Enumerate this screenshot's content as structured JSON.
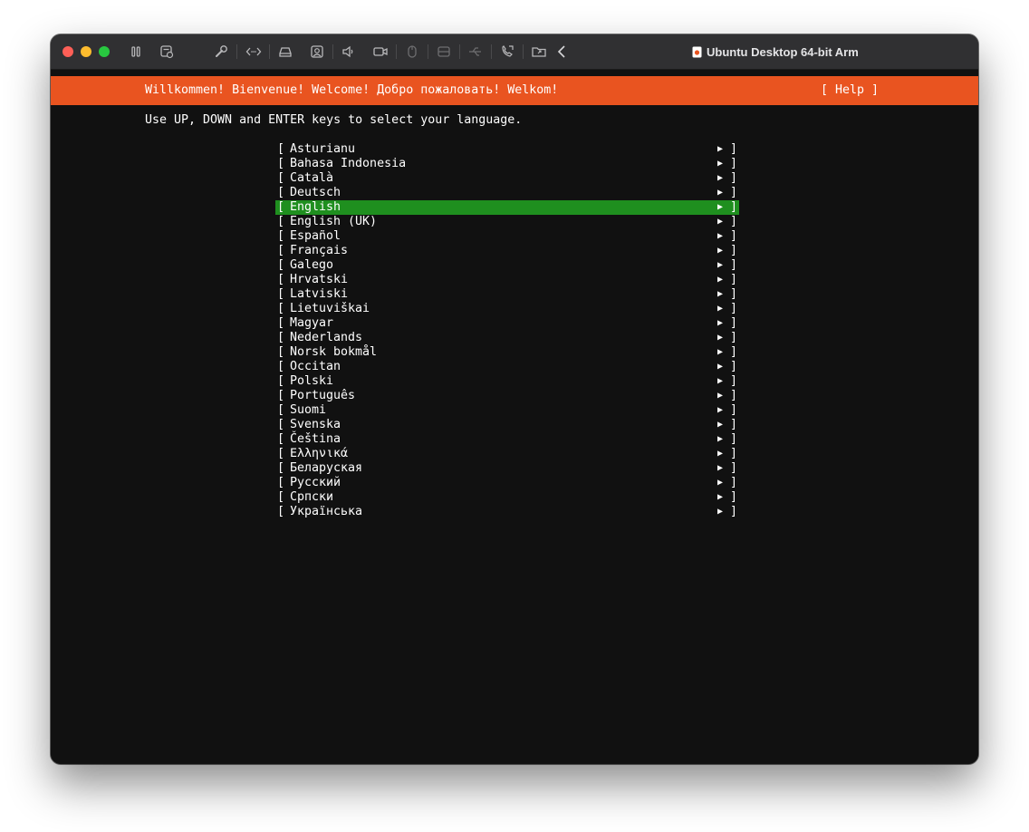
{
  "window": {
    "title": "Ubuntu Desktop 64-bit Arm"
  },
  "toolbar": {
    "icons": [
      "pause-icon",
      "snapshot-icon",
      "settings-wrench-icon",
      "code-icon",
      "hard-disk-icon",
      "camera-icon",
      "sound-icon",
      "video-camera-icon",
      "mouse-icon",
      "drive-icon",
      "usb-icon",
      "connect-icon",
      "shared-folder-icon",
      "chevron-left-icon"
    ]
  },
  "installer": {
    "banner": "Willkommen! Bienvenue! Welcome! Добро пожаловать! Welkom!",
    "help": "[ Help ]",
    "instruction": "Use UP, DOWN and ENTER keys to select your language.",
    "bracket_open": "[",
    "bracket_close": "]",
    "arrow": "▶",
    "languages": [
      {
        "label": "Asturianu"
      },
      {
        "label": "Bahasa Indonesia"
      },
      {
        "label": "Català"
      },
      {
        "label": "Deutsch"
      },
      {
        "label": "English"
      },
      {
        "label": "English (UK)"
      },
      {
        "label": "Español"
      },
      {
        "label": "Français"
      },
      {
        "label": "Galego"
      },
      {
        "label": "Hrvatski"
      },
      {
        "label": "Latviski"
      },
      {
        "label": "Lietuviškai"
      },
      {
        "label": "Magyar"
      },
      {
        "label": "Nederlands"
      },
      {
        "label": "Norsk bokmål"
      },
      {
        "label": "Occitan"
      },
      {
        "label": "Polski"
      },
      {
        "label": "Português"
      },
      {
        "label": "Suomi"
      },
      {
        "label": "Svenska"
      },
      {
        "label": "Čeština"
      },
      {
        "label": "Ελληνικά"
      },
      {
        "label": "Беларуская"
      },
      {
        "label": "Русский"
      },
      {
        "label": "Српски"
      },
      {
        "label": "Українська"
      }
    ],
    "selected_language": "English"
  },
  "colors": {
    "banner_orange": "#e95420",
    "selection_green": "#1f8f1f",
    "terminal_bg": "#111111",
    "titlebar_bg": "#303032"
  }
}
